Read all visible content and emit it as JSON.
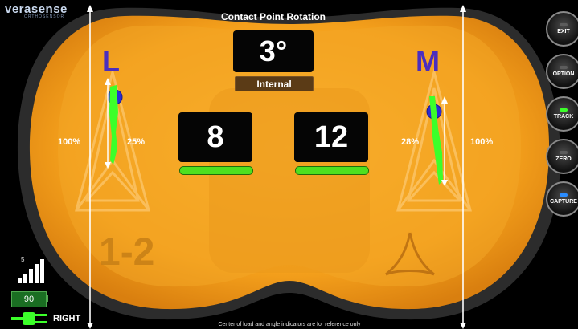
{
  "app": {
    "logo_text": "verasense",
    "logo_subtext": "ORTHOSENSOR"
  },
  "header": {
    "title": "Contact Point Rotation"
  },
  "rotation": {
    "value": "3°",
    "direction": "Internal"
  },
  "lateral": {
    "letter": "L",
    "load": "8",
    "outer_percent": "100%",
    "inner_percent": "25%",
    "bar_fill": 1.0
  },
  "medial": {
    "letter": "M",
    "load": "12",
    "inner_percent": "28%",
    "outer_percent": "100%",
    "bar_fill": 1.0
  },
  "config": {
    "label": "1-2"
  },
  "footer": {
    "note": "Center of load and angle indicators are for reference only"
  },
  "status": {
    "signal_count": "5",
    "signal_icon": "signal-bars-icon",
    "battery_level": "90",
    "side_label": "RIGHT",
    "plug_icon": "plug-icon"
  },
  "buttons": [
    {
      "label": "EXIT",
      "led_color": "#5c5c5c"
    },
    {
      "label": "OPTION",
      "led_color": "#5c5c5c"
    },
    {
      "label": "TRACK",
      "led_color": "#3cff2a"
    },
    {
      "label": "ZERO",
      "led_color": "#5c5c5c"
    },
    {
      "label": "CAPTURE",
      "led_color": "#2a8cff"
    }
  ],
  "colors": {
    "insert_orange": "#f4a11e",
    "insert_dark": "#d47a0f",
    "track_green": "#3cff2a",
    "bar_green": "#4fe01f",
    "letter_purple": "#4a2ebf"
  }
}
